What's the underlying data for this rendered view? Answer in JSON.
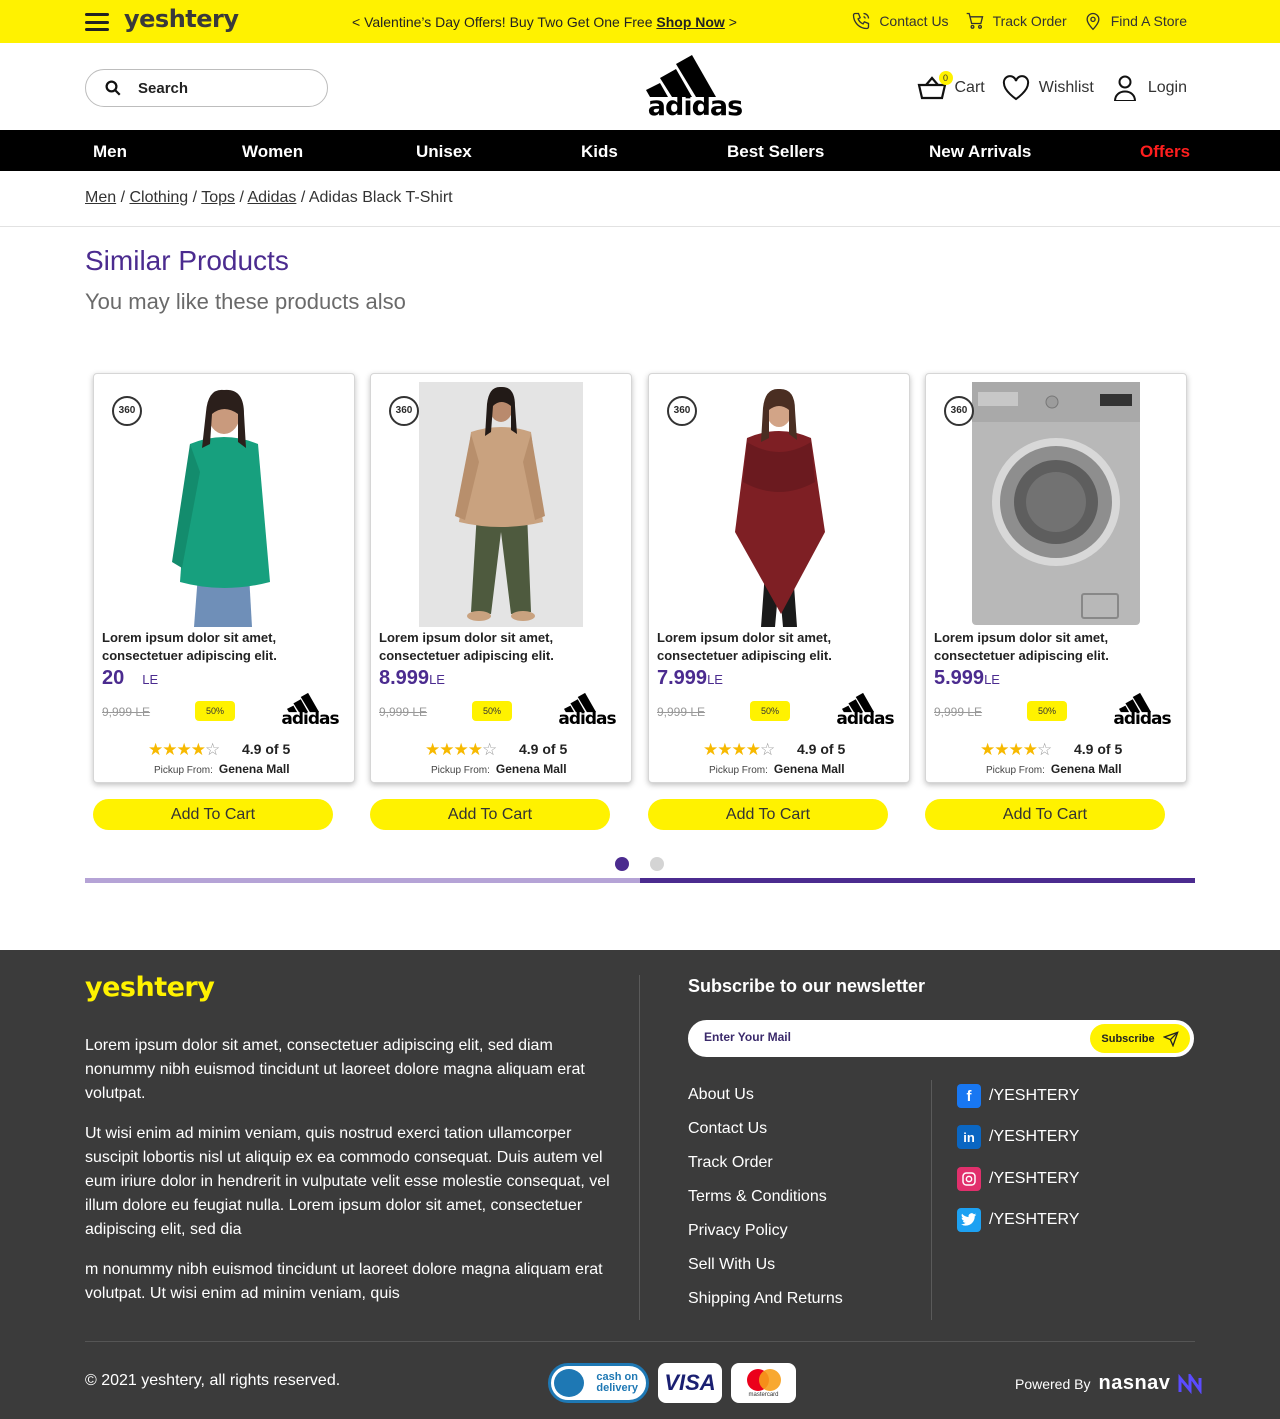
{
  "topbar": {
    "logo": "yeshtery",
    "promo_prefix": "< Valentine’s Day Offers! Buy Two Get One Free ",
    "promo_link": "Shop Now",
    "promo_suffix": " >",
    "links": [
      {
        "label": "Contact Us",
        "icon": "phone-icon"
      },
      {
        "label": "Track Order",
        "icon": "cart-icon"
      },
      {
        "label": "Find A Store",
        "icon": "location-pin-icon"
      }
    ]
  },
  "header": {
    "search_placeholder": "Search",
    "brand": "adidas",
    "cart_label": "Cart",
    "cart_count": "0",
    "wishlist_label": "Wishlist",
    "login_label": "Login"
  },
  "nav": [
    "Men",
    "Women",
    "Unisex",
    "Kids",
    "Best Sellers",
    "New Arrivals",
    "Offers"
  ],
  "breadcrumb": {
    "links": [
      "Men",
      "Clothing",
      "Tops",
      "Adidas"
    ],
    "current": "Adidas Black T-Shirt"
  },
  "section": {
    "title": "Similar Products",
    "subtitle": "You may like these products also"
  },
  "products": [
    {
      "title": "Lorem ipsum dolor sit amet, consectetuer adipiscing elit.",
      "price": "20",
      "currency": "LE",
      "old_price": "9,999 LE",
      "discount": "50%",
      "brand": "adidas",
      "rating": "4.9 of 5",
      "stars_filled": 4,
      "pickup_label": "Pickup From:",
      "pickup_store": "Genena Mall",
      "badge": "360",
      "add_label": "Add To Cart",
      "image": "woman-green-sweater"
    },
    {
      "title": "Lorem ipsum dolor sit amet, consectetuer adipiscing elit.",
      "price": "8.999",
      "currency": "LE",
      "old_price": "9,999 LE",
      "discount": "50%",
      "brand": "adidas",
      "rating": "4.9 of 5",
      "stars_filled": 4,
      "pickup_label": "Pickup From:",
      "pickup_store": "Genena Mall",
      "badge": "360",
      "add_label": "Add To Cart",
      "image": "woman-beige-blouse"
    },
    {
      "title": "Lorem ipsum dolor sit amet, consectetuer adipiscing elit.",
      "price": "7.999",
      "currency": "LE",
      "old_price": "9,999 LE",
      "discount": "50%",
      "brand": "adidas",
      "rating": "4.9 of 5",
      "stars_filled": 4,
      "pickup_label": "Pickup From:",
      "pickup_store": "Genena Mall",
      "badge": "360",
      "add_label": "Add To Cart",
      "image": "woman-red-poncho"
    },
    {
      "title": "Lorem ipsum dolor sit amet, consectetuer adipiscing elit.",
      "price": "5.999",
      "currency": "LE",
      "old_price": "9,999 LE",
      "discount": "50%",
      "brand": "adidas",
      "rating": "4.9 of 5",
      "stars_filled": 4,
      "pickup_label": "Pickup From:",
      "pickup_store": "Genena Mall",
      "badge": "360",
      "add_label": "Add To Cart",
      "image": "washing-machine"
    }
  ],
  "carousel": {
    "pages": 2,
    "active": 1
  },
  "footer": {
    "logo": "yeshtery",
    "paragraphs": [
      "Lorem ipsum dolor sit amet, consectetuer adipiscing elit, sed diam nonummy nibh euismod tincidunt ut laoreet dolore magna aliquam erat volutpat.",
      "Ut wisi enim ad minim veniam, quis nostrud exerci tation ullamcorper suscipit lobortis nisl ut aliquip ex ea commodo consequat. Duis autem vel eum iriure dolor in hendrerit in vulputate velit esse molestie consequat, vel illum dolore eu feugiat nulla. Lorem ipsum dolor sit amet, consectetuer adipiscing elit, sed dia",
      "m nonummy nibh euismod tincidunt ut laoreet dolore magna aliquam erat volutpat. Ut wisi enim ad minim veniam, quis"
    ],
    "newsletter_title": "Subscribe to our newsletter",
    "newsletter_placeholder": "Enter Your Mail",
    "subscribe_label": "Subscribe",
    "links": [
      "About Us",
      "Contact Us",
      "Track Order",
      "Terms & Conditions",
      "Privacy Policy",
      "Sell With Us",
      "Shipping And Returns"
    ],
    "socials": [
      {
        "icon": "facebook-icon",
        "label": "/YESHTERY",
        "color": "#1877f2"
      },
      {
        "icon": "linkedin-icon",
        "label": "/YESHTERY",
        "color": "#0a66c2"
      },
      {
        "icon": "instagram-icon",
        "label": "/YESHTERY",
        "color": "#e1306c"
      },
      {
        "icon": "twitter-icon",
        "label": "/YESHTERY",
        "color": "#1da1f2"
      }
    ],
    "copyright": "© 2021 yeshtery, all rights reserved.",
    "payments": {
      "cod_line1": "cash on",
      "cod_line2": "delivery",
      "visa": "VISA",
      "mastercard": "mastercard"
    },
    "powered_by": "Powered By",
    "powered_brand": "nasnav"
  },
  "colors": {
    "accent_yellow": "#fff200",
    "brand_purple": "#4b2b8f",
    "offers_red": "#ff1e1e",
    "footer_bg": "#3b3b3b",
    "star": "#f7b900"
  }
}
